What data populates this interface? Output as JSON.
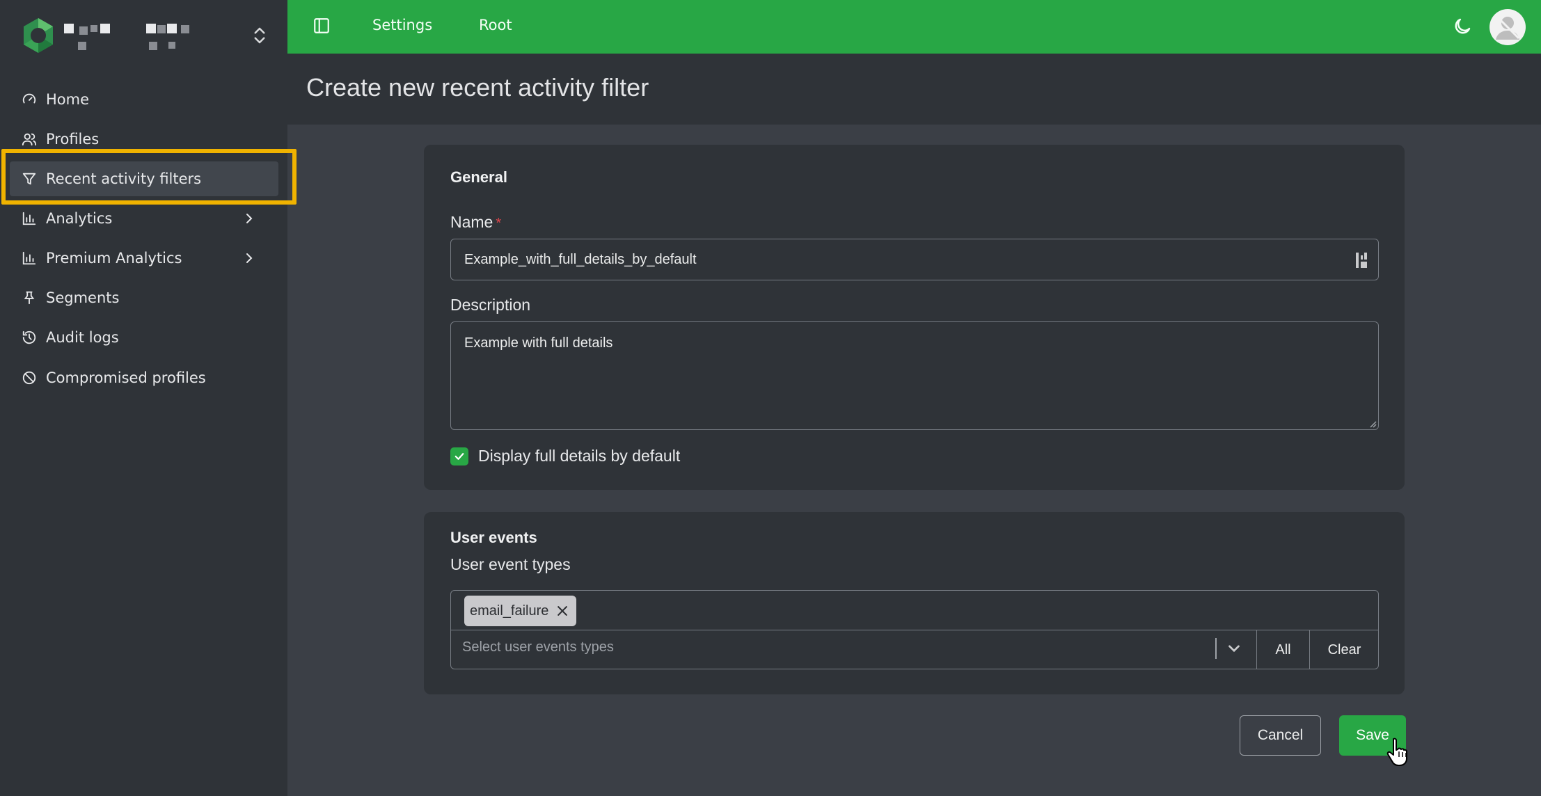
{
  "topbar": {
    "links": [
      "Settings",
      "Root"
    ],
    "accent": "#28a745"
  },
  "sidebar": {
    "items": [
      {
        "label": "Home",
        "icon": "gauge-icon"
      },
      {
        "label": "Profiles",
        "icon": "users-icon"
      },
      {
        "label": "Recent activity filters",
        "icon": "filter-icon",
        "active": true
      },
      {
        "label": "Analytics",
        "icon": "bar-chart-icon",
        "expandable": true
      },
      {
        "label": "Premium Analytics",
        "icon": "bar-chart-icon",
        "expandable": true
      },
      {
        "label": "Segments",
        "icon": "pin-icon"
      },
      {
        "label": "Audit logs",
        "icon": "history-icon"
      },
      {
        "label": "Compromised profiles",
        "icon": "ban-icon"
      }
    ]
  },
  "page": {
    "title": "Create new recent activity filter"
  },
  "general": {
    "heading": "General",
    "name_label": "Name",
    "required_mark": "*",
    "name_value": "Example_with_full_details_by_default",
    "description_label": "Description",
    "description_value": "Example with full details",
    "checkbox_label": "Display full details by default",
    "checkbox_checked": true
  },
  "user_events": {
    "heading": "User events",
    "types_label": "User event types",
    "tags": [
      "email_failure"
    ],
    "placeholder": "Select user events types",
    "all_label": "All",
    "clear_label": "Clear"
  },
  "actions": {
    "cancel_label": "Cancel",
    "save_label": "Save"
  }
}
